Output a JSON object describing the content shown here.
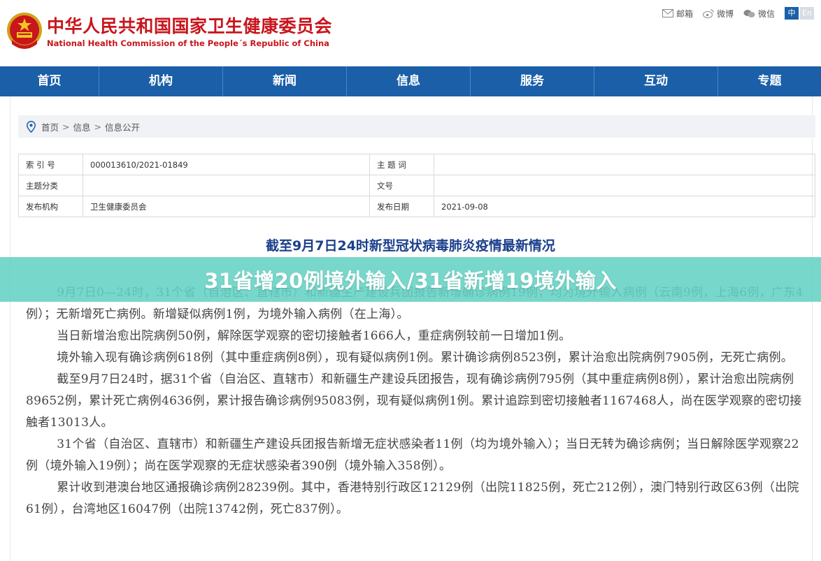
{
  "header": {
    "title_cn": "中华人民共和国国家卫生健康委员会",
    "title_en": "National Health Commission of the People´s Republic of China",
    "links": [
      {
        "icon": "mail-icon",
        "label": "邮箱"
      },
      {
        "icon": "weibo-icon",
        "label": "微博"
      },
      {
        "icon": "wechat-icon",
        "label": "微信"
      }
    ],
    "lang_zh": "中",
    "lang_en": "En"
  },
  "nav": [
    "首页",
    "机构",
    "新闻",
    "信息",
    "服务",
    "互动",
    "专题"
  ],
  "breadcrumb": {
    "items": [
      "首页",
      "信息",
      "信息公开"
    ],
    "separator": ">"
  },
  "meta": {
    "index_label": "索 引 号",
    "index_value": "000013610/2021-01849",
    "subject_label": "主 题 词",
    "subject_value": "",
    "category_label": "主题分类",
    "category_value": "",
    "doc_label": "文号",
    "doc_value": "",
    "publisher_label": "发布机构",
    "publisher_value": "卫生健康委员会",
    "date_label": "发布日期",
    "date_value": "2021-09-08"
  },
  "article": {
    "title": "截至9月7日24时新型冠状病毒肺炎疫情最新情况",
    "paragraphs": [
      "9月7日0—24时，31个省（自治区、直辖市）和新疆生产建设兵团报告新增确诊病例19例，均为境外输入病例（云南9例，上海6例，广东4例）；无新增死亡病例。新增疑似病例1例，为境外输入病例（在上海）。",
      "当日新增治愈出院病例50例，解除医学观察的密切接触者1666人，重症病例较前一日增加1例。",
      "境外输入现有确诊病例618例（其中重症病例8例），现有疑似病例1例。累计确诊病例8523例，累计治愈出院病例7905例，无死亡病例。",
      "截至9月7日24时，据31个省（自治区、直辖市）和新疆生产建设兵团报告，现有确诊病例795例（其中重症病例8例），累计治愈出院病例89652例，累计死亡病例4636例，累计报告确诊病例95083例，现有疑似病例1例。累计追踪到密切接触者1167468人，尚在医学观察的密切接触者13013人。",
      "31个省（自治区、直辖市）和新疆生产建设兵团报告新增无症状感染者11例（均为境外输入）；当日无转为确诊病例；当日解除医学观察22例（境外输入19例）；尚在医学观察的无症状感染者390例（境外输入358例）。",
      "累计收到港澳台地区通报确诊病例28239例。其中，香港特别行政区12129例（出院11825例，死亡212例），澳门特别行政区63例（出院61例），台湾地区16047例（出院13742例，死亡837例）。"
    ]
  },
  "banner": {
    "text": "31省增20例境外输入/31省新增19境外输入"
  },
  "colors": {
    "brand_red": "#c8161d",
    "nav_blue": "#1b5fa8",
    "title_blue": "#1b3f8c",
    "banner_teal": "#64d2c3"
  }
}
